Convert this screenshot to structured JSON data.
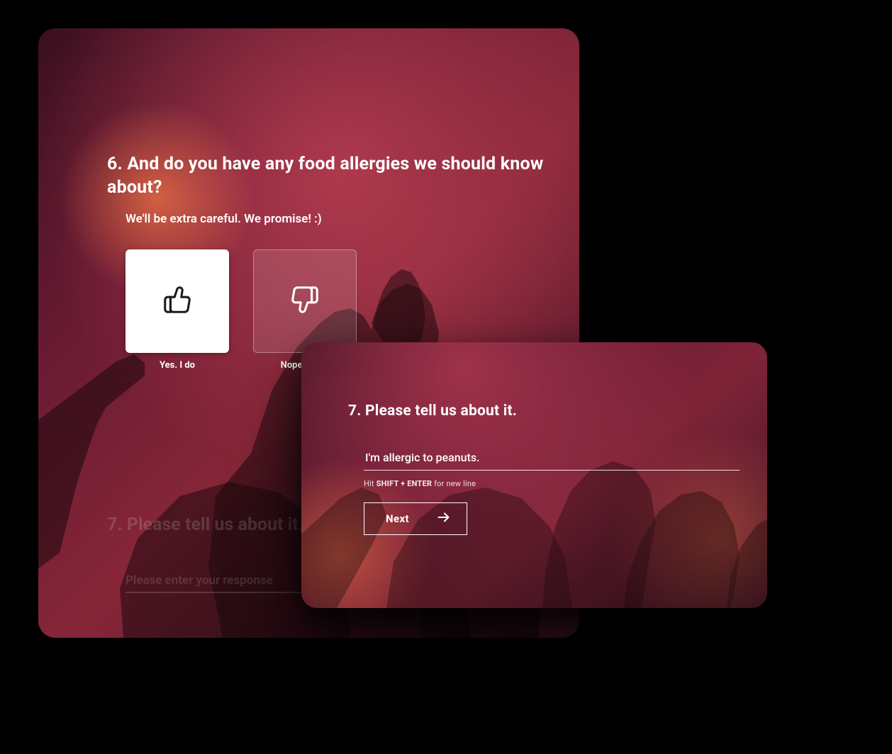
{
  "q6": {
    "number": "6.",
    "title": "And do you have any food allergies we should know about?",
    "subtitle": "We'll be extra careful. We promise! :)",
    "options": [
      {
        "label": "Yes. I do",
        "icon": "thumbs-up-icon",
        "selected": true
      },
      {
        "label": "Nope. None",
        "icon": "thumbs-down-icon",
        "selected": false
      }
    ]
  },
  "q7dim": {
    "number": "7.",
    "title": "Please tell us about it.",
    "placeholder": "Please enter your response"
  },
  "q7": {
    "number": "7.",
    "title": "Please tell us about it.",
    "value": "I'm allergic to peanuts.",
    "help_prefix": "Hit ",
    "help_keys": "SHIFT + ENTER",
    "help_suffix": " for new line",
    "next_label": "Next"
  },
  "colors": {
    "accent": "#ffffff"
  }
}
